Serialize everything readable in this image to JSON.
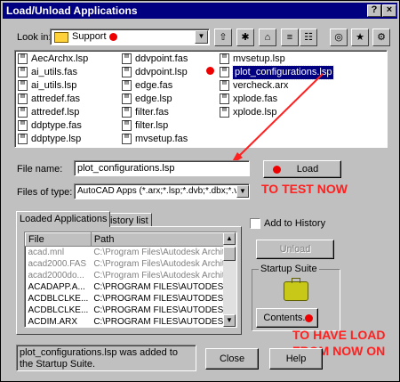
{
  "window": {
    "title": "Load/Unload Applications"
  },
  "lookin": {
    "label": "Look in:",
    "value": "Support"
  },
  "files": {
    "col1": [
      "AecArchx.lsp",
      "ai_utils.fas",
      "ai_utils.lsp",
      "attredef.fas",
      "attredef.lsp",
      "ddptype.fas",
      "ddptype.lsp"
    ],
    "col2": [
      "ddvpoint.fas",
      "ddvpoint.lsp",
      "edge.fas",
      "edge.lsp",
      "filter.fas",
      "filter.lsp",
      "mvsetup.fas"
    ],
    "col3": [
      "mvsetup.lsp",
      "plot_configurations.lsp",
      "vercheck.arx",
      "xplode.fas",
      "xplode.lsp"
    ]
  },
  "filename": {
    "label": "File name:",
    "value": "plot_configurations.lsp"
  },
  "filetype": {
    "label": "Files of type:",
    "value": "AutoCAD Apps (*.arx;*.lsp;*.dvb;*.dbx;*.vlx;*.f"
  },
  "buttons": {
    "load": "Load",
    "unload": "Unload",
    "contents": "Contents...",
    "close": "Close",
    "help": "Help"
  },
  "tabs": {
    "loaded": "Loaded Applications",
    "history": "History list"
  },
  "loaded_table": {
    "headers": [
      "File",
      "Path"
    ],
    "rows": [
      [
        "acad.mnl",
        "C:\\Program Files\\Autodesk Architec..."
      ],
      [
        "acad2000.FAS",
        "C:\\Program Files\\Autodesk Architec..."
      ],
      [
        "acad2000do...",
        "C:\\Program Files\\Autodesk Architec..."
      ],
      [
        "ACADAPP.A...",
        "C:\\PROGRAM FILES\\AUTODESK ..."
      ],
      [
        "ACDBLCLKE...",
        "C:\\PROGRAM FILES\\AUTODESK ..."
      ],
      [
        "ACDBLCLKE...",
        "C:\\PROGRAM FILES\\AUTODESK ..."
      ],
      [
        "ACDIM.ARX",
        "C:\\PROGRAM FILES\\AUTODESK ..."
      ]
    ]
  },
  "add_history": {
    "label": "Add to History"
  },
  "startup_suite": {
    "label": "Startup Suite"
  },
  "status": {
    "text": "plot_configurations.lsp was added to the Startup Suite."
  },
  "annotations": {
    "test_now": "TO TEST NOW",
    "load_now_line1": "TO HAVE LOAD",
    "load_now_line2": "FROM NOW ON"
  },
  "colors": {
    "titlebar": "#000080",
    "annotation": "#ff2020",
    "selection": "#000080"
  }
}
